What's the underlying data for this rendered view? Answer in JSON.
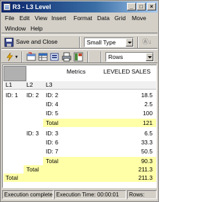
{
  "window": {
    "title": "R3 - L3 Level",
    "min_glyph": "_",
    "max_glyph": "□",
    "close_glyph": "×"
  },
  "menu": {
    "row1": [
      {
        "label": "File"
      },
      {
        "label": "Edit"
      },
      {
        "label": "View"
      },
      {
        "label": "Insert"
      },
      {
        "label": "Format"
      },
      {
        "label": "Data"
      },
      {
        "label": "Grid"
      },
      {
        "label": "Move"
      }
    ],
    "row2": [
      {
        "label": "Window"
      },
      {
        "label": "Help"
      }
    ]
  },
  "toolbar1": {
    "save_close_label": "Save and Close",
    "report_type": "Small Type",
    "sort_glyph": "Ⓐ↓"
  },
  "toolbar2": {
    "axis_select": "Rows"
  },
  "grid": {
    "header": {
      "metrics_label": "Metrics",
      "metric_name": "LEVELED SALES",
      "col_l1": "L1",
      "col_l2": "L2",
      "col_l3": "L3"
    },
    "rows": [
      {
        "l1": "ID: 1",
        "l2": "ID: 2",
        "l3": "ID: 2",
        "value": "18.5"
      },
      {
        "l1": "",
        "l2": "",
        "l3": "ID: 4",
        "value": "2.5"
      },
      {
        "l1": "",
        "l2": "",
        "l3": "ID: 5",
        "value": "100"
      },
      {
        "l1": "",
        "l2": "",
        "l3": "Total",
        "value": "121"
      },
      {
        "l1": "",
        "l2": "ID: 3",
        "l3": "ID: 3",
        "value": "6.5"
      },
      {
        "l1": "",
        "l2": "",
        "l3": "ID: 6",
        "value": "33.3"
      },
      {
        "l1": "",
        "l2": "",
        "l3": "ID: 7",
        "value": "50.5"
      },
      {
        "l1": "",
        "l2": "",
        "l3": "Total",
        "value": "90.3"
      },
      {
        "l1": "",
        "l2": "Total",
        "l3": "",
        "value": "211.3"
      },
      {
        "l1": "Total",
        "l2": "",
        "l3": "",
        "value": "211.3"
      }
    ],
    "total_color": "#ffffa8"
  },
  "status": {
    "message": "Execution complete",
    "exec_time": "Execution Time: 00:00:01",
    "rows": "Rows:"
  },
  "icons": [
    "app-grid-icon",
    "save-disk-icon",
    "auto-sort-icon",
    "pivot-icon",
    "table-icon",
    "export-icon",
    "print-icon",
    "layout-icon",
    "lightning-icon"
  ]
}
